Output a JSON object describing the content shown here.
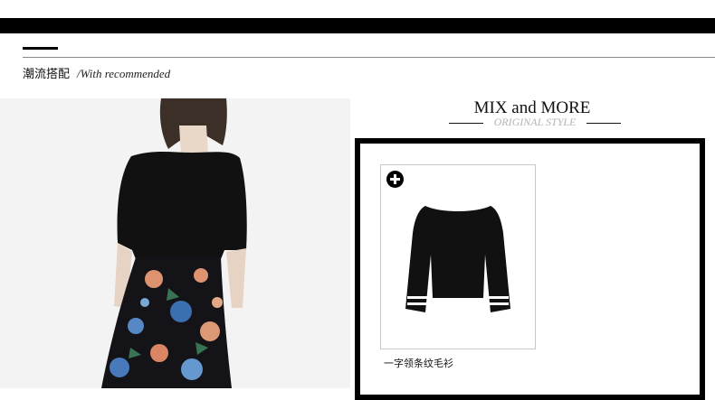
{
  "section": {
    "title_cn": "潮流搭配",
    "title_en": "/With recommended"
  },
  "mix": {
    "title": "MIX and MORE",
    "subtitle": "ORIGINAL STYLE"
  },
  "products": [
    {
      "name": "一字领条纹毛衫",
      "action_icon": "plus-circle-icon"
    }
  ],
  "colors": {
    "bar": "#000000",
    "rule": "#8a8a8a",
    "subtitle": "#b4b4b4"
  }
}
